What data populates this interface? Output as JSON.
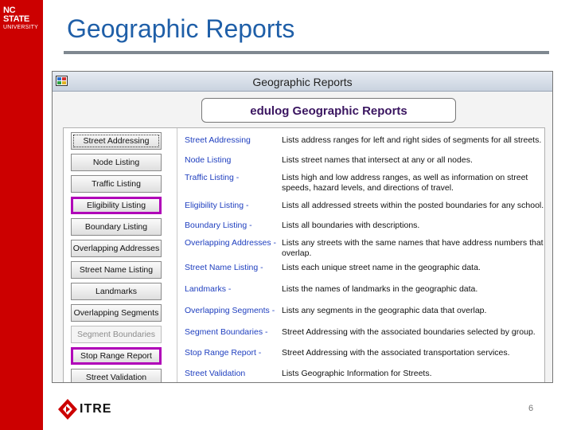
{
  "brand": {
    "ncsu_line1": "NC STATE",
    "ncsu_line2": "UNIVERSITY",
    "left_bar_color": "#cc0000",
    "itre_label": "ITRE"
  },
  "slide": {
    "title": "Geographic Reports",
    "page_number": "6"
  },
  "window": {
    "title": "Geographic Reports",
    "header": "edulog Geographic Reports"
  },
  "reports": [
    {
      "button": "Street Addressing",
      "name": "Street Addressing",
      "desc": "Lists address ranges for left and right sides of segments for all streets.",
      "state": "focused"
    },
    {
      "button": "Node Listing",
      "name": "Node Listing",
      "desc": "Lists street names that intersect at any or all nodes.",
      "state": "normal"
    },
    {
      "button": "Traffic Listing",
      "name": "Traffic Listing -",
      "desc": "Lists high and low address ranges, as well as information on street speeds, hazard levels, and directions of travel.",
      "state": "normal"
    },
    {
      "button": "Eligibility Listing",
      "name": "Eligibility Listing -",
      "desc": "Lists all addressed streets within the posted boundaries for any school.",
      "state": "highlight"
    },
    {
      "button": "Boundary Listing",
      "name": "Boundary Listing -",
      "desc": "Lists all boundaries with descriptions.",
      "state": "normal"
    },
    {
      "button": "Overlapping Addresses",
      "name": "Overlapping Addresses -",
      "desc": "Lists any streets with the same names that have address numbers that overlap.",
      "state": "normal"
    },
    {
      "button": "Street Name Listing",
      "name": "Street Name Listing -",
      "desc": "Lists each unique street name in the geographic data.",
      "state": "normal"
    },
    {
      "button": "Landmarks",
      "name": "Landmarks -",
      "desc": "Lists the names of landmarks in the geographic data.",
      "state": "normal"
    },
    {
      "button": "Overlapping Segments",
      "name": "Overlapping Segments -",
      "desc": "Lists any segments in the geographic data that overlap.",
      "state": "normal"
    },
    {
      "button": "Segment Boundaries",
      "name": "Segment Boundaries -",
      "desc": "Street Addressing with the associated boundaries selected by group.",
      "state": "disabled"
    },
    {
      "button": "Stop Range Report",
      "name": "Stop Range Report -",
      "desc": "Street Addressing with the associated transportation services.",
      "state": "highlight"
    },
    {
      "button": "Street Validation",
      "name": "Street Validation",
      "desc": "Lists Geographic Information for Streets.",
      "state": "normal"
    }
  ],
  "colors": {
    "title_blue": "#1f5fa8",
    "highlight_magenta": "#b000b8",
    "report_name_blue": "#1f3fbf"
  },
  "icons": [
    "app-window-icon",
    "itre-arrow-icon"
  ]
}
